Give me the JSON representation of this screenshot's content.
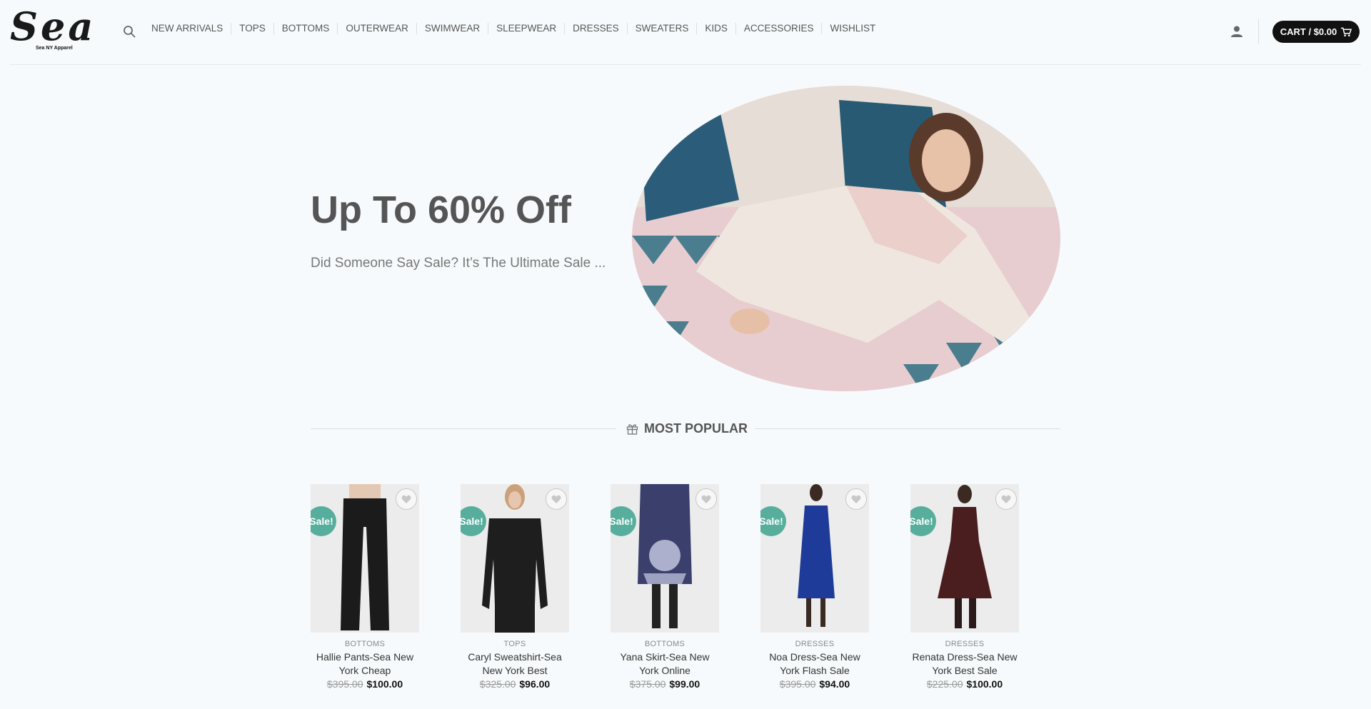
{
  "header": {
    "logo_text": "Sea",
    "logo_tagline": "Sea NY Apparel",
    "nav": [
      "NEW ARRIVALS",
      "TOPS",
      "BOTTOMS",
      "OUTERWEAR",
      "SWIMWEAR",
      "SLEEPWEAR",
      "DRESSES",
      "SWEATERS",
      "KIDS",
      "ACCESSORIES",
      "WISHLIST"
    ],
    "cart_label": "CART / $0.00",
    "icons": {
      "search": "search-icon",
      "account": "user-icon",
      "cart": "shopping-cart-icon"
    }
  },
  "hero": {
    "title": "Up To 60% Off",
    "subtitle": "Did Someone Say Sale? It’s The Ultimate Sale ..."
  },
  "section": {
    "title": "MOST POPULAR",
    "icon": "gift-icon"
  },
  "products": [
    {
      "category": "BOTTOMS",
      "name": "Hallie Pants-Sea New York Cheap",
      "old_price": "$395.00",
      "new_price": "$100.00",
      "badge": "Sale!",
      "color": "#1b1b1b"
    },
    {
      "category": "TOPS",
      "name": "Caryl Sweatshirt-Sea New York Best",
      "old_price": "$325.00",
      "new_price": "$96.00",
      "badge": "Sale!",
      "color": "#1e1e1e"
    },
    {
      "category": "BOTTOMS",
      "name": "Yana Skirt-Sea New York Online",
      "old_price": "$375.00",
      "new_price": "$99.00",
      "badge": "Sale!",
      "color": "#3a3f6b"
    },
    {
      "category": "DRESSES",
      "name": "Noa Dress-Sea New York Flash Sale",
      "old_price": "$395.00",
      "new_price": "$94.00",
      "badge": "Sale!",
      "color": "#1f3b9a"
    },
    {
      "category": "DRESSES",
      "name": "Renata Dress-Sea New York Best Sale",
      "old_price": "$225.00",
      "new_price": "$100.00",
      "badge": "Sale!",
      "color": "#4a1e1e"
    }
  ],
  "colors": {
    "accent": "#57ae9c",
    "cart_bg": "#111111",
    "background": "#f7fafc"
  }
}
